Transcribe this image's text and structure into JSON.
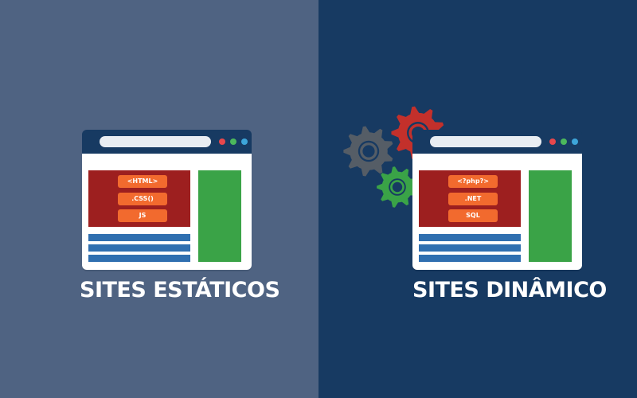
{
  "colors": {
    "left_background": "#4f6382",
    "right_background": "#173a62",
    "window_frame": "#173a62",
    "window_body": "#ffffff",
    "address_bar": "#e9edf2",
    "dot_red": "#e8474c",
    "dot_green": "#4cb85c",
    "dot_blue": "#3da5d9",
    "code_panel": "#9d1f1f",
    "code_tag": "#f26a2e",
    "text_lines": "#2f6fb0",
    "side_block": "#3aa347",
    "caption": "#ffffff",
    "gear_gray": "#555d66",
    "gear_red": "#c3302b",
    "gear_green": "#3aa347"
  },
  "static_site": {
    "caption": "SITES ESTÁTICOS",
    "tags": [
      "<HTML>",
      ".CSS()",
      "JS"
    ]
  },
  "dynamic_site": {
    "caption": "SITES DINÂMICO",
    "tags": [
      "<?php?>",
      ".NET",
      "SQL"
    ]
  },
  "icons": {
    "gears": [
      "gear-gray-icon",
      "gear-red-icon",
      "gear-green-icon"
    ]
  }
}
